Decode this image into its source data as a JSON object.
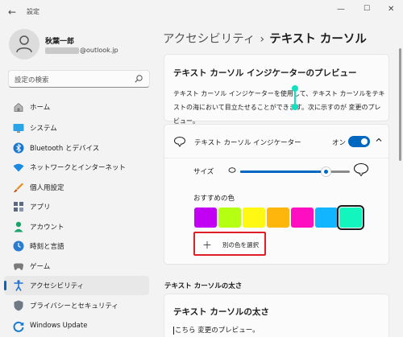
{
  "window": {
    "title": "設定"
  },
  "profile": {
    "name": "秋葉一郎",
    "email_suffix": "@outlook.jp"
  },
  "search": {
    "placeholder": "設定の検索"
  },
  "sidebar": {
    "items": [
      {
        "label": "ホーム",
        "icon": "home-icon"
      },
      {
        "label": "システム",
        "icon": "system-icon"
      },
      {
        "label": "Bluetooth とデバイス",
        "icon": "bluetooth-icon"
      },
      {
        "label": "ネットワークとインターネット",
        "icon": "network-icon"
      },
      {
        "label": "個人用設定",
        "icon": "personalization-icon"
      },
      {
        "label": "アプリ",
        "icon": "apps-icon"
      },
      {
        "label": "アカウント",
        "icon": "accounts-icon"
      },
      {
        "label": "時刻と言語",
        "icon": "time-language-icon"
      },
      {
        "label": "ゲーム",
        "icon": "gaming-icon"
      },
      {
        "label": "アクセシビリティ",
        "icon": "accessibility-icon",
        "selected": true
      },
      {
        "label": "プライバシーとセキュリティ",
        "icon": "privacy-icon"
      },
      {
        "label": "Windows Update",
        "icon": "windows-update-icon"
      }
    ]
  },
  "breadcrumb": {
    "parent": "アクセシビリティ",
    "separator": "›",
    "current": "テキスト カーソル"
  },
  "preview": {
    "title": "テキスト カーソル インジケーターのプレビュー",
    "text": "テキスト カーソル インジケーターを使用して、テキスト カーソルをテキストの海において目立たせることができます。次に示すのが 変更のプレビュー。"
  },
  "indicator": {
    "label": "テキスト カーソル インジケーター",
    "state": "オン",
    "enabled": true,
    "size_label": "サイズ",
    "size_level": 0.78,
    "recommended_colors_label": "おすすめの色",
    "colors": [
      "#c200f4",
      "#b5ff12",
      "#fff714",
      "#ffb60c",
      "#ff0dc1",
      "#12b5ff",
      "#13f5bf"
    ],
    "selected_color": 6,
    "custom_color_label": "別の色を選択"
  },
  "thickness": {
    "section_heading": "テキスト カーソルの太さ",
    "title": "テキスト カーソルの太さ",
    "sample": "こちら 変更のプレビュー。"
  },
  "accent_color": "#0067c0",
  "highlight_color": "#e01e26"
}
